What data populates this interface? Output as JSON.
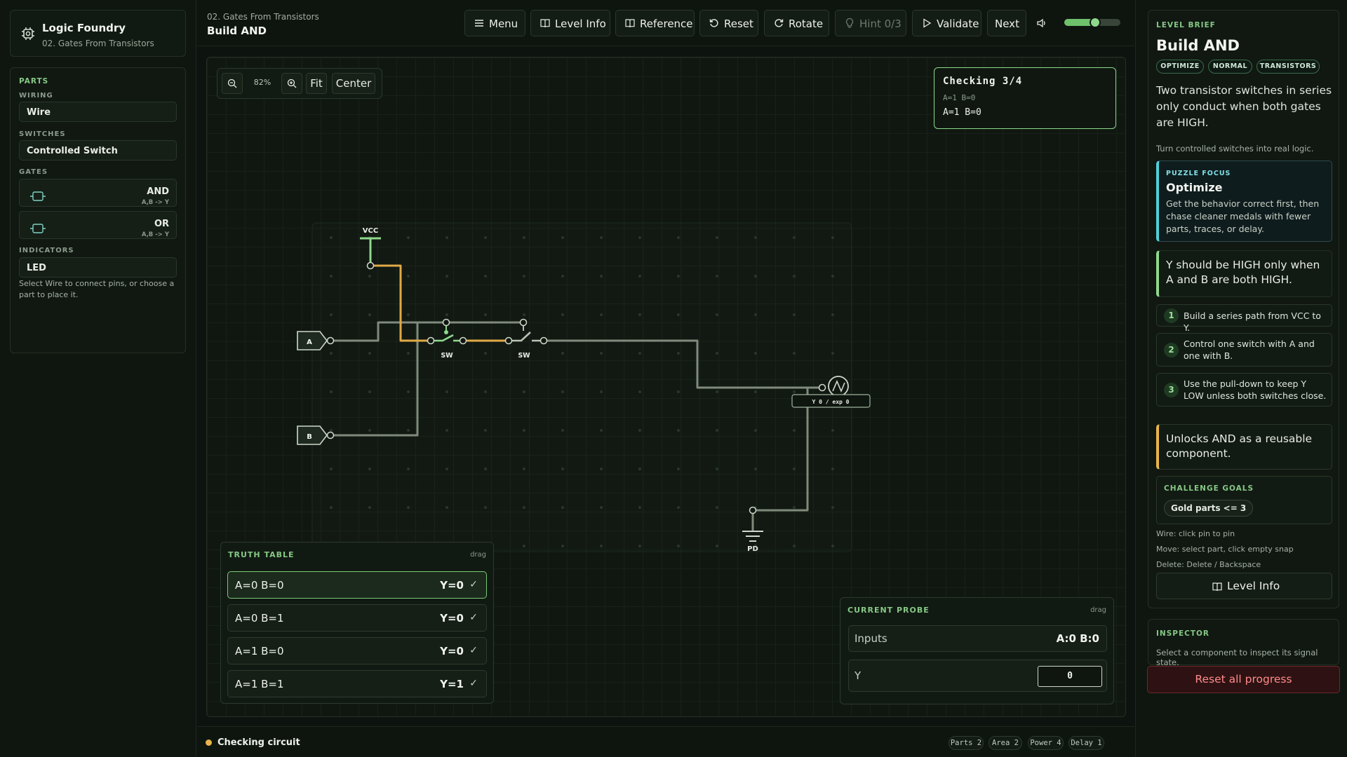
{
  "app": {
    "name": "Logic Foundry",
    "subtitle": "02. Gates From Transistors"
  },
  "parts": {
    "heading": "PARTS",
    "wiring_label": "WIRING",
    "wire": "Wire",
    "switches_label": "SWITCHES",
    "controlled_switch": "Controlled Switch",
    "gates_label": "GATES",
    "gates": [
      {
        "name": "AND",
        "sig": "A,B -> Y"
      },
      {
        "name": "OR",
        "sig": "A,B -> Y"
      }
    ],
    "indicators_label": "INDICATORS",
    "led": "LED",
    "hint": "Select Wire to connect pins, or choose a part to place it."
  },
  "header": {
    "breadcrumb": "02. Gates From Transistors",
    "title": "Build AND",
    "buttons": {
      "menu": "Menu",
      "level_info": "Level Info",
      "reference": "Reference",
      "reset": "Reset",
      "rotate": "Rotate",
      "hint": "Hint 0/3",
      "validate": "Validate",
      "next": "Next"
    },
    "volume": 0.55
  },
  "canvas": {
    "zoom": "82%",
    "fit": "Fit",
    "center": "Center",
    "checking": {
      "title": "Checking 3/4",
      "small": "A=1 B=0",
      "value": "A=1 B=0"
    },
    "labels": {
      "vcc": "VCC",
      "a": "A",
      "b": "B",
      "sw1": "SW",
      "sw2": "SW",
      "led": "Y 0 / exp 0",
      "pd": "PD"
    }
  },
  "truth_table": {
    "heading": "TRUTH TABLE",
    "drag": "drag",
    "rows": [
      {
        "input": "A=0 B=0",
        "output": "Y=0",
        "check": "✓"
      },
      {
        "input": "A=0 B=1",
        "output": "Y=0",
        "check": "✓"
      },
      {
        "input": "A=1 B=0",
        "output": "Y=0",
        "check": "✓"
      },
      {
        "input": "A=1 B=1",
        "output": "Y=1",
        "check": "✓"
      }
    ]
  },
  "probe": {
    "heading": "CURRENT PROBE",
    "drag": "drag",
    "inputs_label": "Inputs",
    "inputs_value": "A:0 B:0",
    "y_label": "Y",
    "y_value": "0"
  },
  "status": {
    "text": "Checking circuit",
    "stats": [
      "Parts 2",
      "Area 2",
      "Power 4",
      "Delay 1"
    ]
  },
  "brief": {
    "heading": "LEVEL BRIEF",
    "title": "Build AND",
    "tags": [
      "OPTIMIZE",
      "NORMAL",
      "TRANSISTORS"
    ],
    "description": "Two transistor switches in series only conduct when both gates are HIGH.",
    "sub": "Turn controlled switches into real logic.",
    "focus": {
      "label": "PUZZLE FOCUS",
      "title": "Optimize",
      "text": "Get the behavior correct first, then chase cleaner medals with fewer parts, traces, or delay."
    },
    "goal": "Y should be HIGH only when A and B are both HIGH.",
    "steps": [
      {
        "n": "1",
        "text": "Build a series path from VCC to Y."
      },
      {
        "n": "2",
        "text": "Control one switch with A and one with B."
      },
      {
        "n": "3",
        "text": "Use the pull-down to keep Y LOW unless both switches close."
      }
    ],
    "unlock": "Unlocks AND as a reusable component.",
    "challenge": {
      "heading": "CHALLENGE GOALS",
      "goal": "Gold parts <= 3"
    },
    "help": [
      "Wire: click pin to pin",
      "Move: select part, click empty snap",
      "Delete: Delete / Backspace"
    ],
    "level_info": "Level Info"
  },
  "inspector": {
    "heading": "INSPECTOR",
    "text": "Select a component to inspect its signal state."
  },
  "reset_all": "Reset all progress",
  "colors": {
    "accent": "#8fd88c",
    "wire": "#7f8a7c",
    "active_wire": "#e2a948",
    "focus": "#4fd0d8",
    "danger": "#ff8a8a"
  }
}
